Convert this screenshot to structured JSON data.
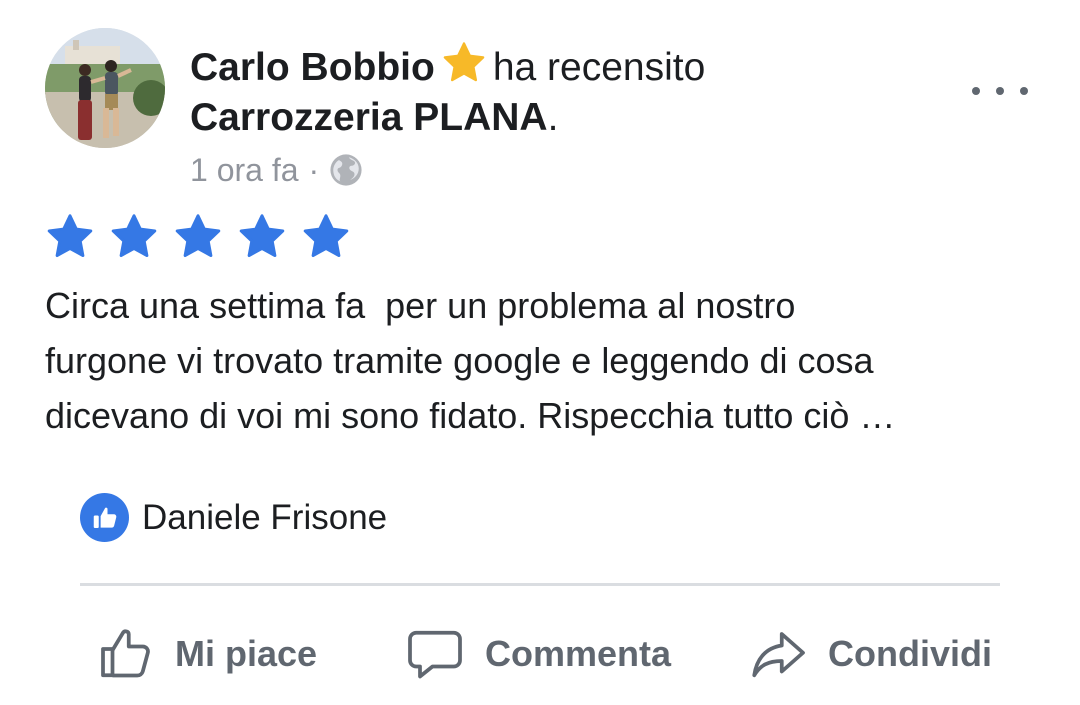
{
  "post": {
    "author": "Carlo Bobbio",
    "author_badge_icon": "star-badge-icon",
    "verb": "ha recensito",
    "page_name": "Carrozzeria PLANA",
    "page_suffix": ".",
    "timestamp": "1 ora fa",
    "separator": "·",
    "privacy_icon": "globe-icon",
    "rating": 5,
    "rating_max": 5,
    "rating_color": "#3578e5",
    "badge_color": "#f7b928",
    "review_lines": [
      "Circa una settima fa  per un problema al nostro",
      "furgone vi trovato tramite google e leggendo di cosa",
      "dicevano di voi mi sono fidato. Rispecchia tutto ciò …"
    ]
  },
  "reactions": {
    "icon": "like-badge-icon",
    "names": "Daniele Frisone"
  },
  "actions": {
    "like_label": "Mi piace",
    "comment_label": "Commenta",
    "share_label": "Condividi"
  }
}
